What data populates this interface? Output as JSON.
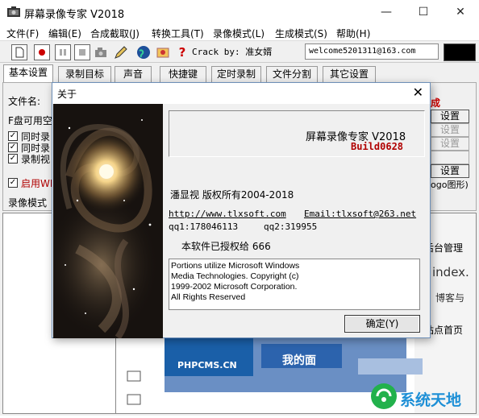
{
  "window": {
    "title": "屏幕录像专家  V2018",
    "minimize": "—",
    "maximize": "☐",
    "close": "✕"
  },
  "menu": [
    "文件(F)",
    "编辑(E)",
    "合成截取(J)",
    "转换工具(T)",
    "录像模式(L)",
    "生成模式(S)",
    "帮助(H)"
  ],
  "toolbar": {
    "crack_text": "Crack by: 准女婿",
    "email": "welcome5201311@163.com",
    "help_glyph": "?"
  },
  "tabs": [
    "基本设置",
    "录制目标",
    "声音",
    "快捷键",
    "定时录制",
    "文件分割",
    "其它设置"
  ],
  "main": {
    "filename_label": "文件名:",
    "disk_label": "F盘可用空",
    "check1": "同时录",
    "check2": "同时录",
    "check3": "录制视",
    "enable_label": "启用WI",
    "record_mode_label": "录像模式",
    "generate_label": "成",
    "btn_settings1": "设置",
    "btn_settings2": "设置",
    "btn_settings3": "设置",
    "btn_settings4": "设置",
    "logo_text": "ogo图形)"
  },
  "web": {
    "site": "PHPCMS.CN",
    "mine": "我的面",
    "backstage": "后台管理",
    "index": "index.",
    "blog": "博客与",
    "station": "站点首页"
  },
  "dialog": {
    "title": "关于",
    "close": "✕",
    "product": "屏幕录像专家  V2018",
    "build": "Build0628",
    "copyright": "潘显视  版权所有2004-2018",
    "url": "http://www.tlxsoft.com",
    "email": "Email:tlxsoft@263.net",
    "qq1": "qq1:178046113",
    "qq2": "qq2:319955",
    "licensed": "本软件已授权给  666",
    "ms_lines": [
      "Portions utilize Microsoft Windows",
      "Media Technologies.  Copyright (c)",
      "1999-2002 Microsoft Corporation.",
      "All Rights Reserved"
    ],
    "ok": "确定(Y)"
  },
  "watermark": {
    "text": "系统天地"
  },
  "colors": {
    "build_red": "#b00000",
    "watermark_green": "#22b14c",
    "web_blue": "#1a5fa8"
  }
}
